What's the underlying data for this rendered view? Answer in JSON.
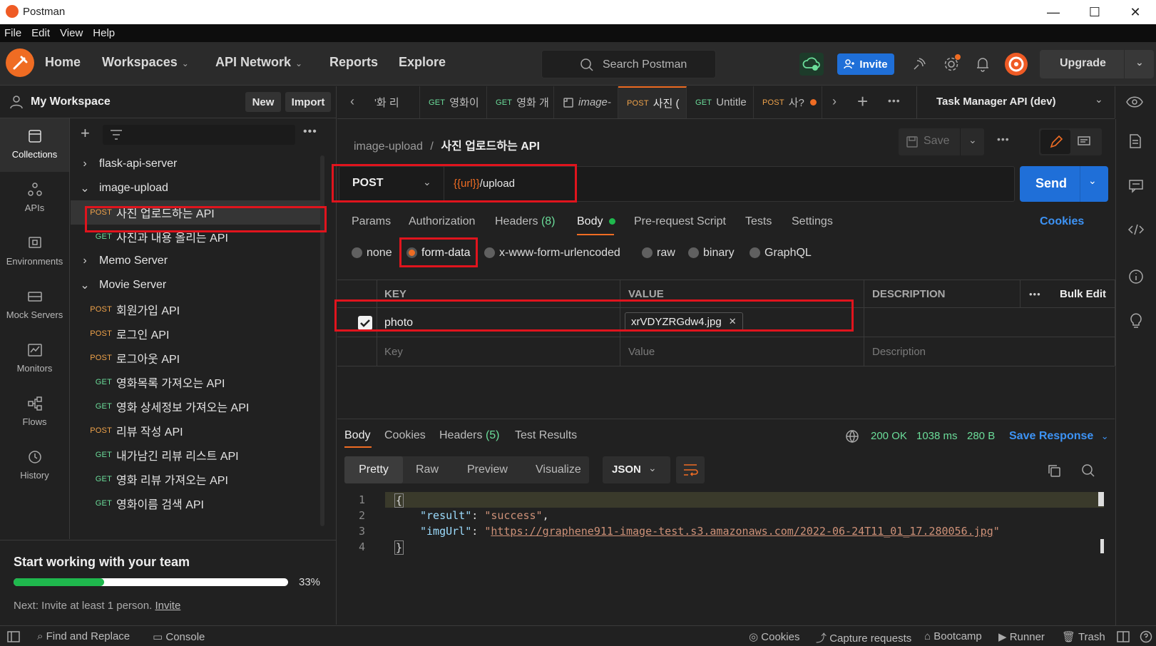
{
  "window": {
    "title": "Postman",
    "minimize": "—",
    "maximize": "☐",
    "close": "✕"
  },
  "menu": [
    "File",
    "Edit",
    "View",
    "Help"
  ],
  "header": {
    "nav": [
      "Home",
      "Workspaces",
      "API Network",
      "Reports",
      "Explore"
    ],
    "search_placeholder": "Search Postman",
    "invite_label": "Invite",
    "upgrade_label": "Upgrade"
  },
  "sidebar": {
    "workspace_name": "My Workspace",
    "new_label": "New",
    "import_label": "Import",
    "rail": [
      {
        "label": "Collections",
        "icon": "collections-icon"
      },
      {
        "label": "APIs",
        "icon": "apis-icon"
      },
      {
        "label": "Environments",
        "icon": "environments-icon"
      },
      {
        "label": "Mock Servers",
        "icon": "mock-servers-icon"
      },
      {
        "label": "Monitors",
        "icon": "monitors-icon"
      },
      {
        "label": "Flows",
        "icon": "flows-icon"
      },
      {
        "label": "History",
        "icon": "history-icon"
      }
    ],
    "tree": [
      {
        "type": "folder",
        "label": "flask-api-server",
        "open": false
      },
      {
        "type": "folder",
        "label": "image-upload",
        "open": true
      },
      {
        "type": "request",
        "method": "POST",
        "label": "사진 업로드하는 API",
        "selected": true
      },
      {
        "type": "request",
        "method": "GET",
        "label": "사진과 내용 올리는 API"
      },
      {
        "type": "folder",
        "label": "Memo Server",
        "open": false
      },
      {
        "type": "folder",
        "label": "Movie Server",
        "open": true
      },
      {
        "type": "request",
        "method": "POST",
        "label": "회원가입 API"
      },
      {
        "type": "request",
        "method": "POST",
        "label": "로그인 API"
      },
      {
        "type": "request",
        "method": "POST",
        "label": "로그아웃 API"
      },
      {
        "type": "request",
        "method": "GET",
        "label": "영화목록 가져오는 API"
      },
      {
        "type": "request",
        "method": "GET",
        "label": "영화 상세정보 가져오는 API"
      },
      {
        "type": "request",
        "method": "POST",
        "label": "리뷰 작성 API"
      },
      {
        "type": "request",
        "method": "GET",
        "label": "내가남긴 리뷰 리스트 API"
      },
      {
        "type": "request",
        "method": "GET",
        "label": "영화 리뷰 가져오는 API"
      },
      {
        "type": "request",
        "method": "GET",
        "label": "영화이름 검색 API"
      }
    ],
    "team": {
      "title": "Start working with your team",
      "progress_percent": 33,
      "progress_label": "33%",
      "next_text": "Next: Invite at least 1 person.",
      "next_link": "Invite"
    }
  },
  "tabs": [
    {
      "method": "",
      "label": "'화 리"
    },
    {
      "method": "GET",
      "label": "영화이"
    },
    {
      "method": "GET",
      "label": "영화 개"
    },
    {
      "method": "",
      "label": "image-"
    },
    {
      "method": "POST",
      "label": "사진 ("
    },
    {
      "method": "GET",
      "label": "Untitle"
    },
    {
      "method": "POST",
      "label": "사?"
    }
  ],
  "environment": "Task Manager API (dev)",
  "request": {
    "breadcrumb_parent": "image-upload",
    "breadcrumb_sep": "/",
    "breadcrumb_name": "사진 업로드하는 API",
    "save_label": "Save",
    "method": "POST",
    "url_var": "{{url}}",
    "url_path": "/upload",
    "send_label": "Send",
    "subtabs": [
      {
        "label": "Params"
      },
      {
        "label": "Authorization"
      },
      {
        "label": "Headers",
        "count": "(8)"
      },
      {
        "label": "Body",
        "active": true
      },
      {
        "label": "Pre-request Script"
      },
      {
        "label": "Tests"
      },
      {
        "label": "Settings"
      }
    ],
    "cookies_label": "Cookies",
    "body_modes": [
      "none",
      "form-data",
      "x-www-form-urlencoded",
      "raw",
      "binary",
      "GraphQL"
    ],
    "body_mode_selected": "form-data",
    "table": {
      "headers": [
        "KEY",
        "VALUE",
        "DESCRIPTION"
      ],
      "bulk_edit": "Bulk Edit",
      "rows": [
        {
          "checked": true,
          "key": "photo",
          "value": "xrVDYZRGdw4.jpg",
          "description": ""
        }
      ],
      "placeholder": {
        "key": "Key",
        "value": "Value",
        "description": "Description"
      }
    }
  },
  "response": {
    "tabs": [
      {
        "label": "Body",
        "active": true
      },
      {
        "label": "Cookies"
      },
      {
        "label": "Headers",
        "count": "(5)"
      },
      {
        "label": "Test Results"
      }
    ],
    "status": "200 OK",
    "time": "1038 ms",
    "size": "280 B",
    "save_response": "Save Response",
    "view_modes": [
      "Pretty",
      "Raw",
      "Preview",
      "Visualize"
    ],
    "format": "JSON",
    "lines": [
      {
        "n": "1",
        "text": "{"
      },
      {
        "n": "2",
        "key": "\"result\"",
        "value": "\"success\""
      },
      {
        "n": "3",
        "key": "\"imgUrl\"",
        "value": "https://graphene911-image-test.s3.amazonaws.com/2022-06-24T11_01_17.280056.jpg"
      },
      {
        "n": "4",
        "text": "}"
      }
    ]
  },
  "footer": {
    "left": [
      "Find and Replace",
      "Console"
    ],
    "right": [
      "Cookies",
      "Capture requests",
      "Bootcamp",
      "Runner",
      "Trash"
    ]
  },
  "colors": {
    "accent_orange": "#ef6c23",
    "send_blue": "#1f6fd8",
    "status_green": "#6bdd9a",
    "annotation_red": "#e0141d"
  }
}
